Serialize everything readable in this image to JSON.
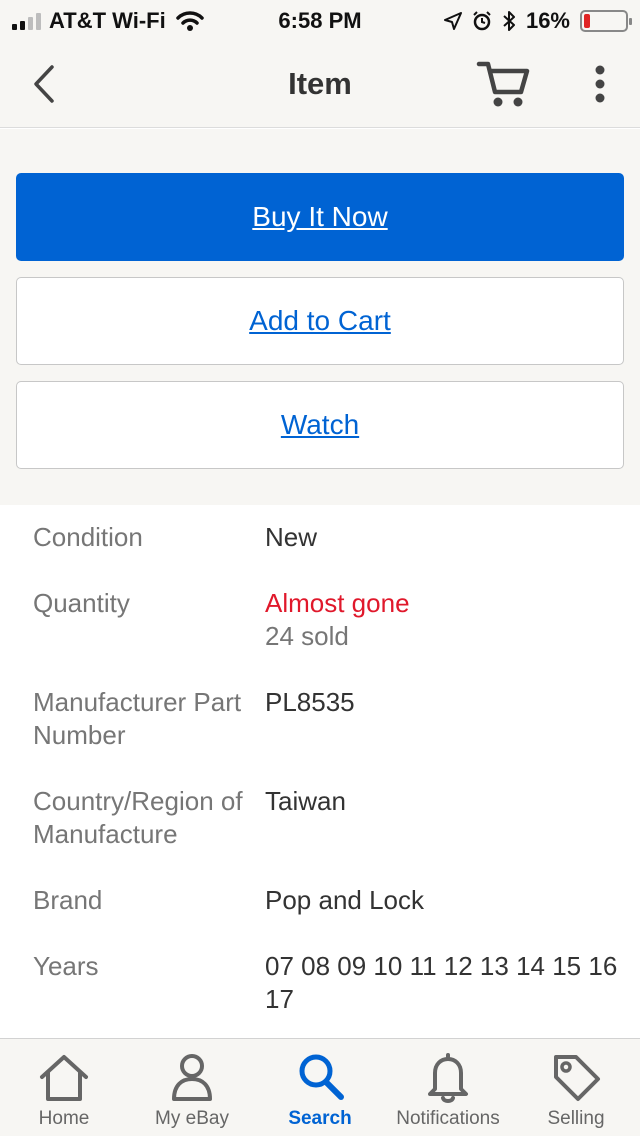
{
  "status_bar": {
    "carrier": "AT&T Wi-Fi",
    "time": "6:58 PM",
    "battery": "16%",
    "battery_level": 0.16,
    "battery_color": "#e02424"
  },
  "nav": {
    "title": "Item",
    "back_icon": "chevron-left-icon",
    "cart_icon": "cart-icon",
    "more_icon": "more-vertical-icon"
  },
  "actions": {
    "buy_now": "Buy It Now",
    "add_to_cart": "Add to Cart",
    "watch": "Watch"
  },
  "colors": {
    "accent": "#0063d3",
    "alert": "#e0182b",
    "background": "#f7f6f3"
  },
  "specifics": [
    {
      "label": "Condition",
      "value": "New"
    },
    {
      "label": "Quantity",
      "value": "Almost gone",
      "subvalue": "24 sold"
    },
    {
      "label": "Manufacturer Part Number",
      "value": "PL8535"
    },
    {
      "label": "Country/Region of Manufacture",
      "value": "Taiwan"
    },
    {
      "label": "Brand",
      "value": "Pop and Lock"
    },
    {
      "label": "Years",
      "value": "07 08 09 10 11 12 13 14 15 16 17"
    }
  ],
  "tabs": [
    {
      "label": "Home",
      "icon": "home-icon",
      "active": false
    },
    {
      "label": "My eBay",
      "icon": "person-icon",
      "active": false
    },
    {
      "label": "Search",
      "icon": "search-icon",
      "active": true
    },
    {
      "label": "Notifications",
      "icon": "bell-icon",
      "active": false
    },
    {
      "label": "Selling",
      "icon": "tag-icon",
      "active": false
    }
  ]
}
